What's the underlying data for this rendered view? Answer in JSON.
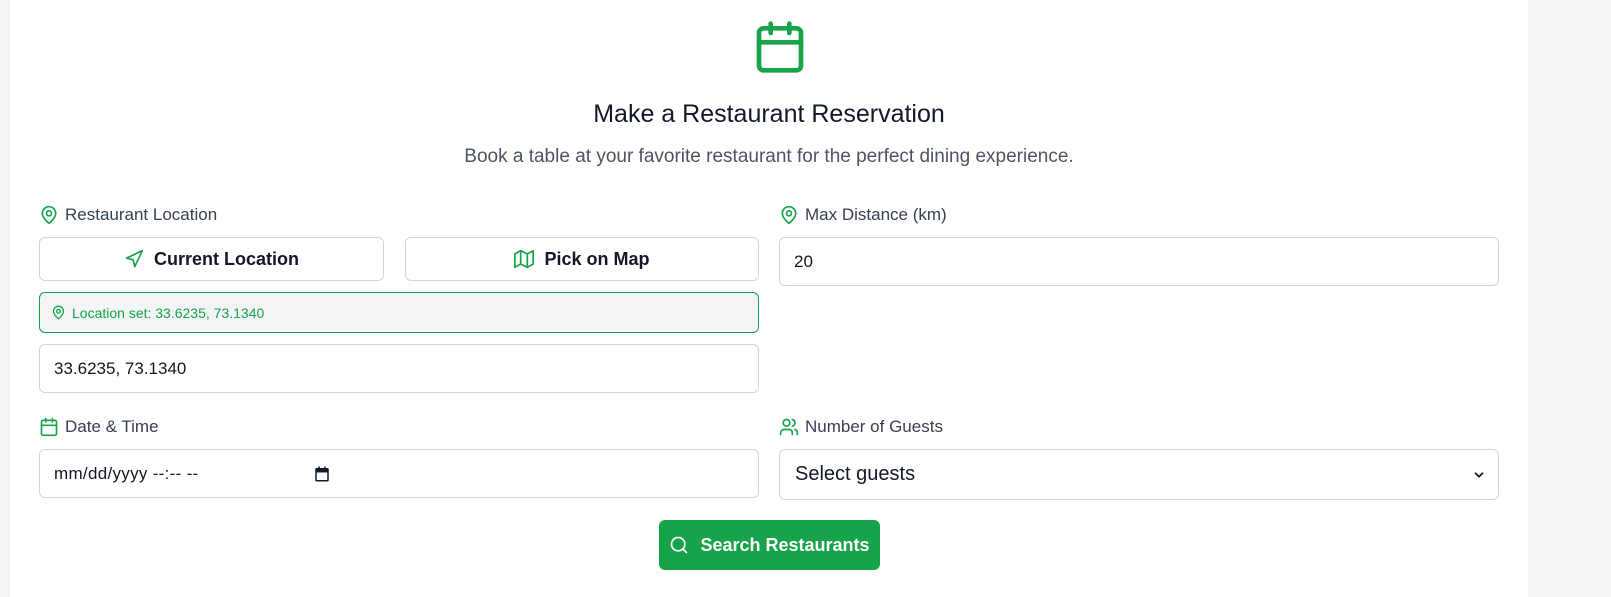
{
  "header": {
    "icon": "calendar-icon",
    "title": "Make a Restaurant Reservation",
    "subtitle": "Book a table at your favorite restaurant for the perfect dining experience."
  },
  "location": {
    "label": "Restaurant Location",
    "icon": "map-pin-icon",
    "current_location_label": "Current Location",
    "pick_on_map_label": "Pick on Map",
    "status_text": "Location set: 33.6235, 73.1340",
    "value": "33.6235, 73.1340"
  },
  "distance": {
    "label": "Max Distance (km)",
    "icon": "map-pin-icon",
    "value": "20"
  },
  "datetime": {
    "label": "Date & Time",
    "icon": "calendar-icon",
    "placeholder": "mm/dd/yyyy --:-- --"
  },
  "guests": {
    "label": "Number of Guests",
    "icon": "users-icon",
    "selected": "Select guests"
  },
  "search_button": {
    "label": "Search Restaurants",
    "icon": "search-icon"
  },
  "colors": {
    "accent": "#16a34a",
    "background": "#f3f4f6",
    "card": "#ffffff"
  }
}
